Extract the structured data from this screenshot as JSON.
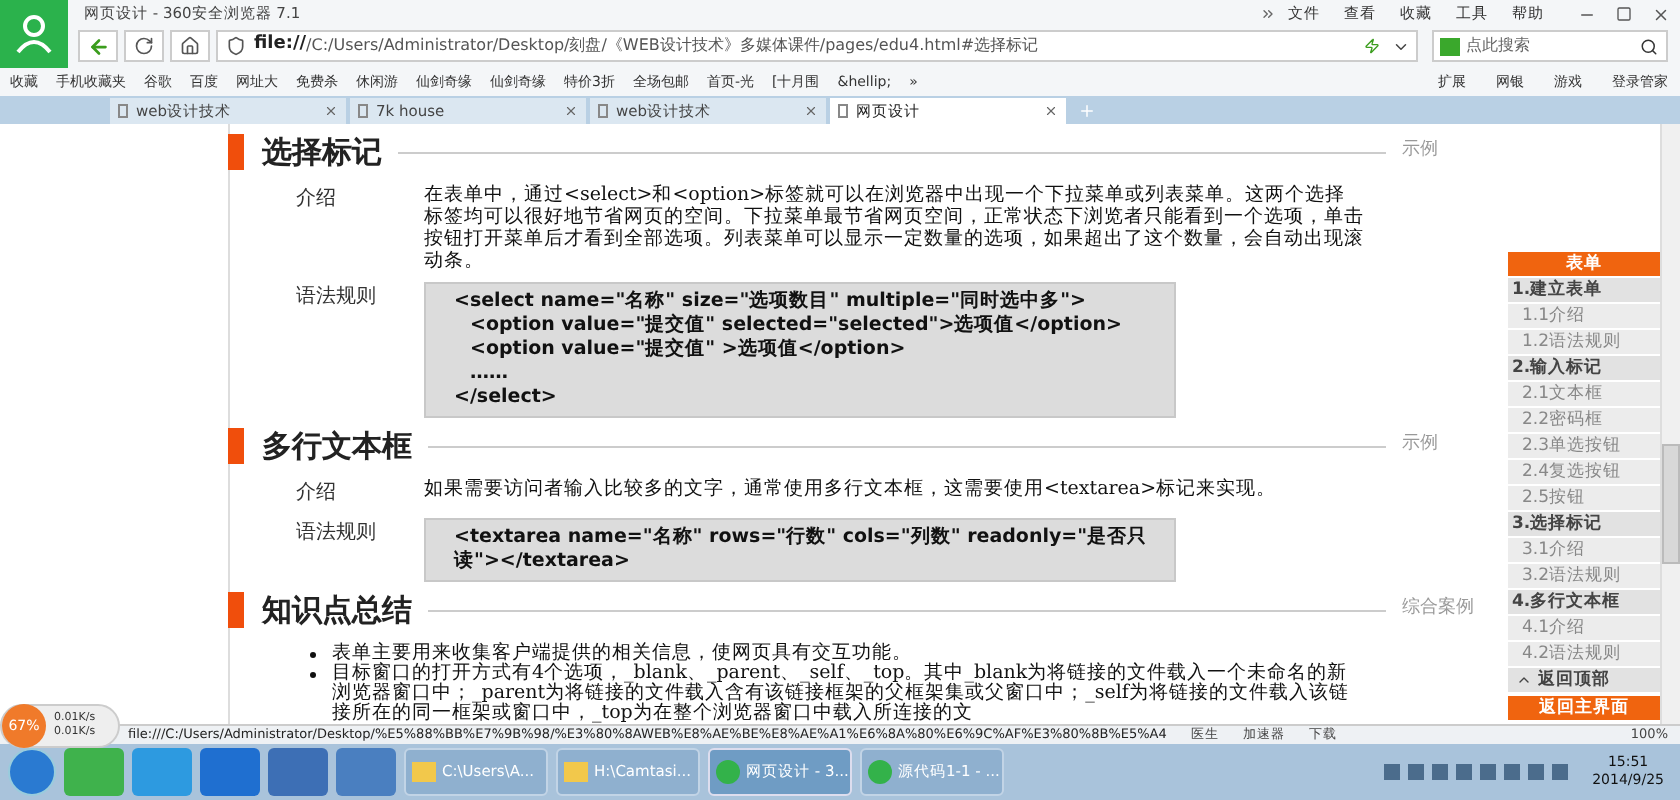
{
  "window": {
    "title": "网页设计 - 360安全浏览器 7.1"
  },
  "menu": [
    "文件",
    "查看",
    "收藏",
    "工具",
    "帮助"
  ],
  "address": {
    "scheme": "file://",
    "path": "/C:/Users/Administrator/Desktop/刻盘/《WEB设计技术》多媒体课件/pages/edu4.html#选择标记"
  },
  "search": {
    "placeholder": "点此搜索"
  },
  "bookmarks": [
    "收藏",
    "手机收藏夹",
    "谷歌",
    "百度",
    "网址大",
    "免费杀",
    "休闲游",
    "仙剑奇缘",
    "仙剑奇缘",
    "特价3折",
    "全场包邮",
    "首页-光",
    "[十月围",
    "&hellip;",
    "»"
  ],
  "toolbar_right": [
    "扩展",
    "网银",
    "游戏",
    "登录管家"
  ],
  "tabs": [
    {
      "label": "web设计技术",
      "selected": false
    },
    {
      "label": "7k house",
      "selected": false
    },
    {
      "label": "web设计技术",
      "selected": false
    },
    {
      "label": "网页设计",
      "selected": true
    }
  ],
  "sections": [
    {
      "title": "选择标记",
      "link": "示例",
      "rows": [
        {
          "kind": "text",
          "label": "介绍",
          "text": "在表单中，通过<select>和<option>标签就可以在浏览器中出现一个下拉菜单或列表菜单。这两个选择标签均可以很好地节省网页的空间。下拉菜单最节省网页空间，正常状态下浏览者只能看到一个选项，单击按钮打开菜单后才看到全部选项。列表菜单可以显示一定数量的选项，如果超出了这个数量，会自动出现滚动条。"
        },
        {
          "kind": "code",
          "label": "语法规则",
          "lines": [
            "<select name=\"名称\"  size=\"选项数目\"  multiple=\"同时选中多\">",
            "<option value=\"提交值\"  selected=\"selected\">选项值</option>",
            "<option value=\"提交值\" >选项值</option>",
            "……",
            "</select>"
          ]
        }
      ]
    },
    {
      "title": "多行文本框",
      "link": "示例",
      "rows": [
        {
          "kind": "text",
          "label": "介绍",
          "text": "如果需要访问者输入比较多的文字，通常使用多行文本框，这需要使用<textarea>标记来实现。"
        },
        {
          "kind": "code",
          "label": "语法规则",
          "lines": [
            "<textarea name=\"名称\"  rows=\"行数\"  cols=\"列数\"  readonly=\"是否只读\"></textarea>"
          ]
        }
      ]
    },
    {
      "title": "知识点总结",
      "link": "综合案例",
      "rows": [
        {
          "kind": "bullets",
          "items": [
            "表单主要用来收集客户端提供的相关信息，使网页具有交互功能。",
            "目标窗口的打开方式有4个选项，_blank、_parent、_self、_top。其中_blank为将链接的文件载入一个未命名的新浏览器窗口中；_parent为将链接的文件载入含有该链接框架的父框架集或父窗口中；_self为将链接的文件载入该链接所在的同一框架或窗口中，_top为在整个浏览器窗口中载入所连接的文"
          ]
        }
      ]
    }
  ],
  "nav": [
    {
      "kind": "header",
      "label": "表单"
    },
    {
      "kind": "section",
      "label": "1.建立表单"
    },
    {
      "kind": "item",
      "label": "1.1介绍"
    },
    {
      "kind": "item",
      "label": "1.2语法规则"
    },
    {
      "kind": "section",
      "label": "2.输入标记"
    },
    {
      "kind": "item",
      "label": "2.1文本框"
    },
    {
      "kind": "item",
      "label": "2.2密码框"
    },
    {
      "kind": "item",
      "label": "2.3单选按钮"
    },
    {
      "kind": "item",
      "label": "2.4复选按钮"
    },
    {
      "kind": "item",
      "label": "2.5按钮"
    },
    {
      "kind": "section",
      "label": "3.选择标记"
    },
    {
      "kind": "item",
      "label": "3.1介绍"
    },
    {
      "kind": "item",
      "label": "3.2语法规则"
    },
    {
      "kind": "section",
      "label": "4.多行文本框"
    },
    {
      "kind": "item",
      "label": "4.1介绍"
    },
    {
      "kind": "item",
      "label": "4.2语法规则"
    },
    {
      "kind": "top",
      "label": "返回顶部"
    },
    {
      "kind": "header",
      "label": "返回主界面"
    }
  ],
  "status_bar": {
    "memory": "67%",
    "up": "0.01K/s",
    "down": "0.01K/s",
    "url": "file:///C:/Users/Administrator/Desktop/%E5%88%BB%E7%9B%98/%E3%80%8AWEB%E8%AE%BE%E8%AE%A1%E6%8A%80%E6%9C%AF%E3%80%8B%E5%A4",
    "items": [
      "医生",
      "加速器",
      "下载"
    ],
    "zoom": "100%"
  },
  "taskbar": {
    "tasks": [
      {
        "label": "C:\\Users\\A...",
        "kind": "folder",
        "selected": false
      },
      {
        "label": "H:\\Camtasi...",
        "kind": "folder",
        "selected": false
      },
      {
        "label": "网页设计 - 3...",
        "kind": "browser",
        "selected": true
      },
      {
        "label": "源代码1-1 - ...",
        "kind": "browser",
        "selected": false
      }
    ],
    "time": "15:51",
    "date": "2014/9/25"
  }
}
